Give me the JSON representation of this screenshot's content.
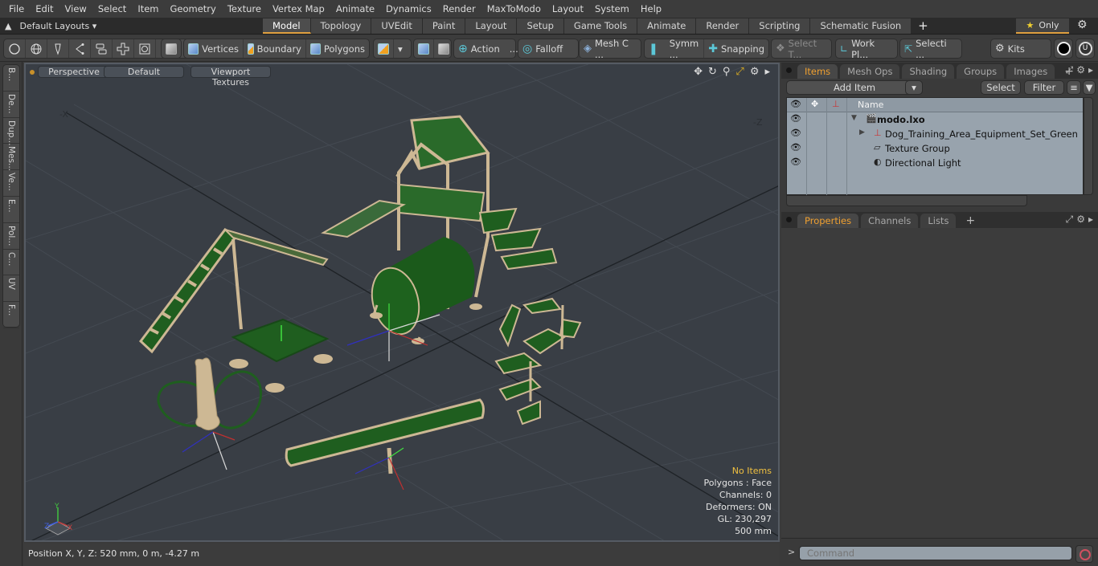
{
  "menu": [
    "File",
    "Edit",
    "View",
    "Select",
    "Item",
    "Geometry",
    "Texture",
    "Vertex Map",
    "Animate",
    "Dynamics",
    "Render",
    "MaxToModo",
    "Layout",
    "System",
    "Help"
  ],
  "layouts": {
    "label": "Default Layouts ▾"
  },
  "layout_tabs": [
    "Model",
    "Topology",
    "UVEdit",
    "Paint",
    "Layout",
    "Setup",
    "Game Tools",
    "Animate",
    "Render",
    "Scripting",
    "Schematic Fusion",
    "+"
  ],
  "active_layout_tab": "Model",
  "only_button": {
    "star": "★",
    "label": "Only"
  },
  "toolbar": {
    "vertices": "Vertices",
    "boundary": "Boundary",
    "polygons": "Polygons",
    "action": "Action",
    "action_more": "...",
    "falloff": "Falloff",
    "mesh_c": "Mesh C ...",
    "symm": "Symm ...",
    "snapping": "Snapping",
    "select_t": "Select T...",
    "work_pl": "Work Pl...",
    "selecti": "Selecti ...",
    "kits": "Kits"
  },
  "left_tabs": [
    "B...",
    "De...",
    "Dup...",
    "Mes...",
    "Ve...",
    "E...",
    "Pol...",
    "C...",
    "UV",
    "F..."
  ],
  "viewport": {
    "view_mode": "Perspective",
    "shading": "Default",
    "textures": "Viewport Textures",
    "axis_neg_x": "-X",
    "axis_neg_z": "-Z",
    "info": {
      "selection": "No Items",
      "polygons": "Polygons : Face",
      "channels": "Channels: 0",
      "deformers": "Deformers: ON",
      "gl": "GL: 230,297",
      "grid": "500 mm"
    },
    "gizmo": {
      "x": "X",
      "y": "Y",
      "z": "Z"
    }
  },
  "status": {
    "position": "Position X, Y, Z:   520 mm, 0 m, -4.27 m"
  },
  "items_panel": {
    "tabs": [
      "Items",
      "Mesh Ops",
      "Shading",
      "Groups",
      "Images",
      "+"
    ],
    "active_tab": "Items",
    "add_item": "Add Item",
    "select": "Select",
    "filter": "Filter",
    "name_header": "Name",
    "rows": [
      {
        "label": "modo.lxo",
        "level": 0,
        "icon": "scene-icon",
        "expanded": true
      },
      {
        "label": "Dog_Training_Area_Equipment_Set_Green",
        "level": 1,
        "icon": "mesh-locator-icon",
        "expanded": false
      },
      {
        "label": "Texture Group",
        "level": 1,
        "icon": "folder-icon"
      },
      {
        "label": "Directional Light",
        "level": 1,
        "icon": "light-icon"
      }
    ]
  },
  "properties_panel": {
    "tabs": [
      "Properties",
      "Channels",
      "Lists",
      "+"
    ],
    "active_tab": "Properties"
  },
  "command": {
    "prompt": ">",
    "placeholder": "Command"
  },
  "colors": {
    "accent": "#e0a040",
    "viewport_bg": "#393e45",
    "equipment_green": "#1f5e1f",
    "equipment_frame": "#cdb894"
  }
}
